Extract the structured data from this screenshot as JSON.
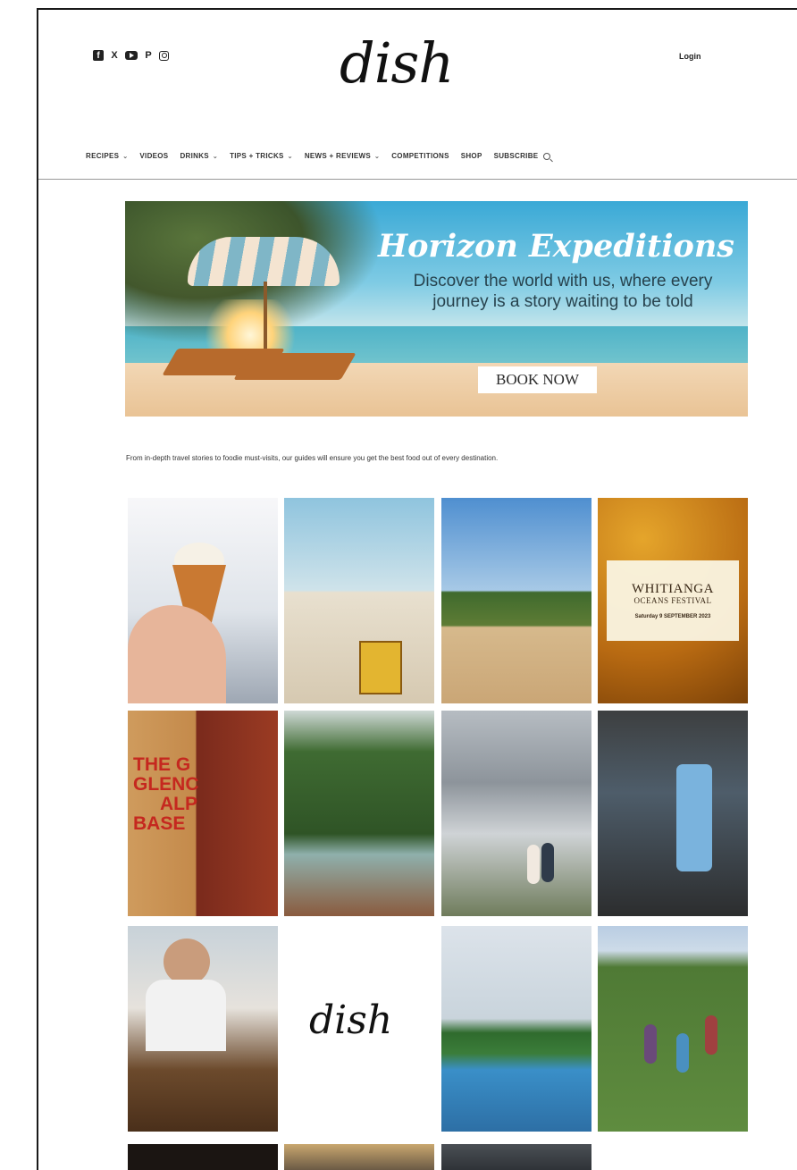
{
  "header": {
    "social_icons": [
      "facebook-icon",
      "x-icon",
      "youtube-icon",
      "pinterest-icon",
      "instagram-icon"
    ],
    "logo": "dish",
    "login": "Login"
  },
  "nav": {
    "items": [
      {
        "label": "RECIPES",
        "dropdown": true
      },
      {
        "label": "VIDEOS",
        "dropdown": false
      },
      {
        "label": "DRINKS",
        "dropdown": true
      },
      {
        "label": "TIPS + TRICKS",
        "dropdown": true
      },
      {
        "label": "NEWS + REVIEWS",
        "dropdown": true
      },
      {
        "label": "COMPETITIONS",
        "dropdown": false
      },
      {
        "label": "SHOP",
        "dropdown": false
      },
      {
        "label": "SUBSCRIBE",
        "dropdown": false
      }
    ],
    "search_icon": "search-icon"
  },
  "banner": {
    "brand": "Horizon Expeditions",
    "tagline": "Discover the world with us, where every journey is a story waiting to be told",
    "cta": "BOOK NOW"
  },
  "intro": "From in-depth travel stories to foodie must-visits, our guides will ensure you get the best food out of every destination.",
  "festival_card": {
    "title": "WHITIANGA",
    "subtitle": "OCEANS FESTIVAL",
    "date": "Saturday 9 SEPTEMBER 2023"
  },
  "glen_sign": [
    "THE G",
    "GLENC",
    "ALP",
    "BASE"
  ],
  "grid_logo": "dish",
  "colors": {
    "text": "#111111",
    "nav_text": "#333333",
    "banner_text": "#27424d",
    "rule": "#999999"
  }
}
